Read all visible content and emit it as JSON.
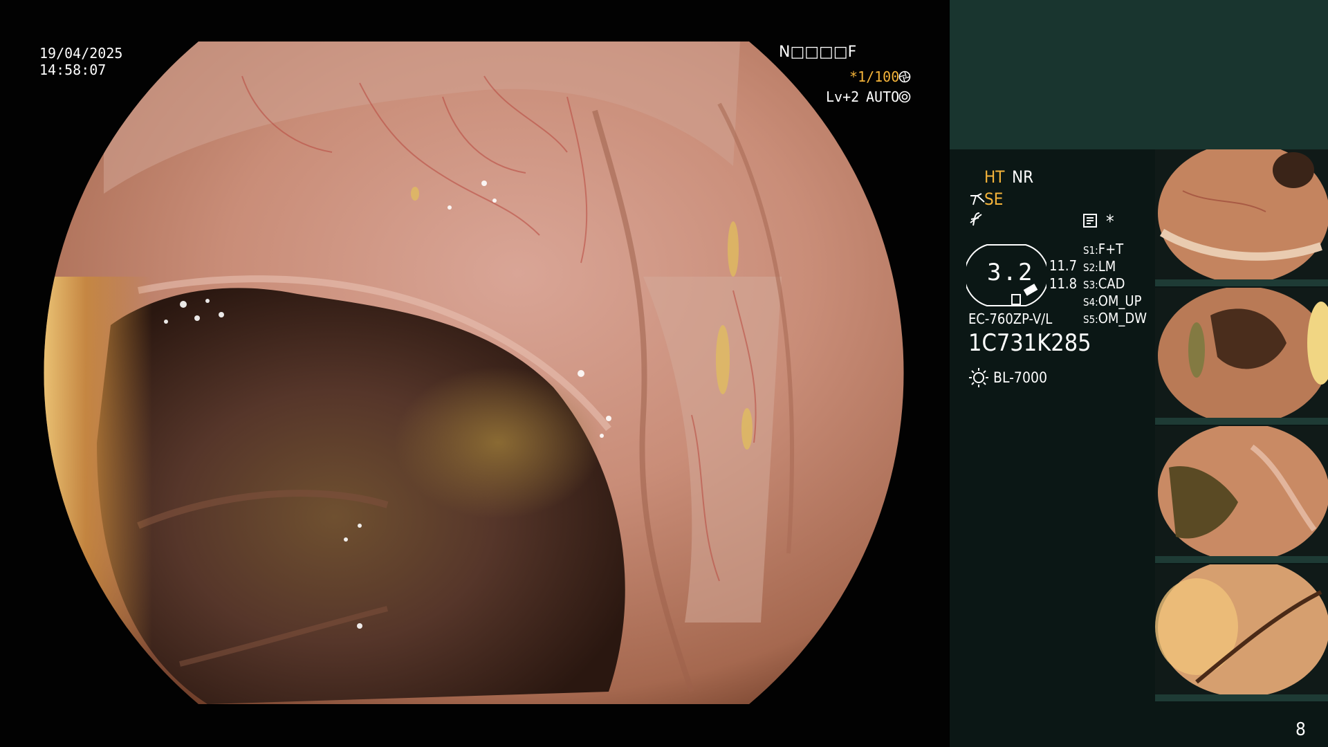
{
  "scope": {
    "date": "19/04/2025",
    "time": "14:58:07",
    "status_code": "N□□□□F",
    "shutter": "*1/100",
    "shutter_icon": "aperture-icon",
    "level": "Lv+2",
    "mode": "AUTO",
    "mode_icon": "gear-icon"
  },
  "panel": {
    "ht": "HT",
    "nr": "NR",
    "se": "SE",
    "se_icon": "scissors-icon",
    "f_icon": "slash-f-icon",
    "doc_icon": "document-icon",
    "asterisk": "*",
    "gauge_value": "3.2",
    "reading_1": "11.7",
    "reading_2": "11.8",
    "presets": [
      {
        "key": "S1",
        "val": "F+T"
      },
      {
        "key": "S2",
        "val": "LM"
      },
      {
        "key": "S3",
        "val": "CAD"
      },
      {
        "key": "S4",
        "val": "OM_UP"
      },
      {
        "key": "S5",
        "val": "OM_DW"
      }
    ],
    "model": "EC-760ZP-V/L",
    "serial": "1C731K285",
    "light_icon": "sun-icon",
    "light_source": "BL-7000",
    "page_number": "8"
  },
  "colors": {
    "panel_bg": "#0b1715",
    "panel_header": "#19352f",
    "accent": "#f5b43a",
    "tissue": "#c98a74"
  }
}
